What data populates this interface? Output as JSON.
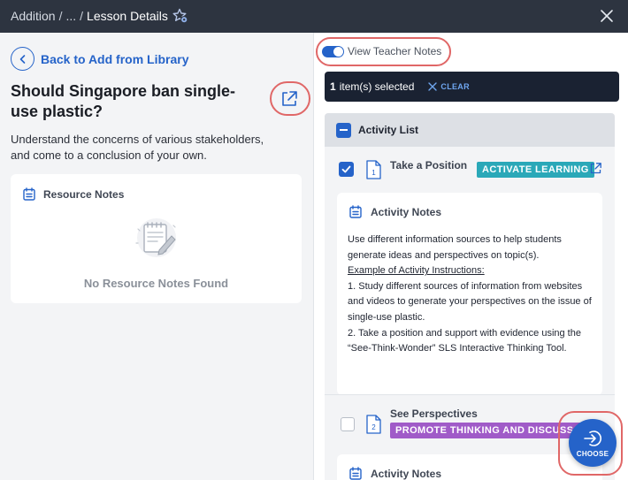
{
  "header": {
    "breadcrumb": [
      "Addition",
      "...",
      "Lesson Details"
    ],
    "breadcrumb_separator": "/"
  },
  "left": {
    "back_label": "Back to Add from Library",
    "title": "Should Singapore ban single-use plastic?",
    "description": "Understand the concerns of various stakeholders, and come to a conclusion of your own.",
    "resource_notes_label": "Resource Notes",
    "empty_text": "No Resource Notes Found"
  },
  "right": {
    "toggle_label": "View Teacher Notes",
    "toggle_on": true,
    "selected_count": "1",
    "selected_text": "item(s) selected",
    "clear_label": "CLEAR",
    "list_header": "Activity List",
    "items": [
      {
        "number": "1",
        "title": "Take a Position",
        "tag": "ACTIVATE LEARNING",
        "checked": true,
        "notes_label": "Activity Notes",
        "notes_intro": "Use different information sources to help students generate ideas and perspectives on topic(s).",
        "notes_example_heading": "Example of Activity Instructions:",
        "notes_step1": "1. Study different sources of information from websites and videos to generate your perspectives on the issue of single-use plastic.",
        "notes_step2": "2. Take a position and support with evidence using the “See-Think-Wonder” SLS Interactive Thinking Tool."
      },
      {
        "number": "2",
        "title": "See Perspectives",
        "tag": "PROMOTE THINKING AND DISCUSS…",
        "checked": false,
        "notes_label": "Activity Notes"
      }
    ],
    "choose_label": "CHOOSE"
  },
  "colors": {
    "header_bg": "#2d3440",
    "accent": "#2563c9",
    "selection_bar": "#1a2232",
    "tag_teal": "#2aa8b8",
    "tag_purple": "#a05bc8",
    "annotation": "#e06767"
  },
  "icons": [
    "star-settings-icon",
    "close-icon",
    "chevron-left-icon",
    "external-link-icon",
    "notes-icon",
    "document-icon",
    "checkmark-icon",
    "x-icon",
    "arrow-into-circle-icon"
  ]
}
